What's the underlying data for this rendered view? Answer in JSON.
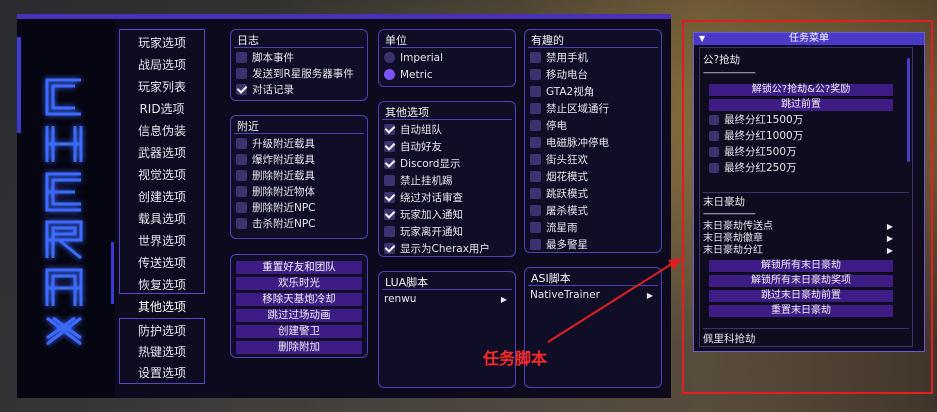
{
  "logo_text": "CHERAX",
  "main_menu": {
    "group1": [
      "玩家选项",
      "战局选项",
      "玩家列表",
      "RID选项",
      "信息伪装",
      "武器选项",
      "视觉选项",
      "创建选项",
      "载具选项",
      "世界选项",
      "传送选项",
      "恢复选项"
    ],
    "active": "其他选项",
    "group2": [
      "防护选项",
      "热键选项",
      "设置选项"
    ]
  },
  "log_panel": {
    "title": "日志",
    "items": [
      {
        "label": "脚本事件",
        "checked": false
      },
      {
        "label": "发送到R星服务器事件",
        "checked": false
      },
      {
        "label": "对话记录",
        "checked": true
      }
    ]
  },
  "nearby_panel": {
    "title": "附近",
    "items": [
      {
        "label": "升级附近载具",
        "checked": false
      },
      {
        "label": "爆炸附近载具",
        "checked": false
      },
      {
        "label": "删除附近载具",
        "checked": false
      },
      {
        "label": "删除附近物体",
        "checked": false
      },
      {
        "label": "删除附近NPC",
        "checked": false
      },
      {
        "label": "击杀附近NPC",
        "checked": false
      }
    ]
  },
  "action_buttons": [
    "重置好友和团队",
    "欢乐时光",
    "移除天基炮冷却",
    "跳过过场动画",
    "创建警卫",
    "删除附加"
  ],
  "unit_panel": {
    "title": "单位",
    "options": [
      {
        "label": "Imperial",
        "selected": false
      },
      {
        "label": "Metric",
        "selected": true
      }
    ]
  },
  "other_panel": {
    "title": "其他选项",
    "items": [
      {
        "label": "自动组队",
        "checked": true
      },
      {
        "label": "自动好友",
        "checked": true
      },
      {
        "label": "Discord显示",
        "checked": true
      },
      {
        "label": "禁止挂机踢",
        "checked": false
      },
      {
        "label": "绕过对话审查",
        "checked": true
      },
      {
        "label": "玩家加入通知",
        "checked": true
      },
      {
        "label": "玩家离开通知",
        "checked": false
      },
      {
        "label": "显示为Cherax用户",
        "checked": true
      }
    ]
  },
  "lua_panel": {
    "title": "LUA脚本",
    "item": "renwu",
    "arrow": "▶"
  },
  "fun_panel": {
    "title": "有趣的",
    "items": [
      {
        "label": "禁用手机",
        "checked": false
      },
      {
        "label": "移动电台",
        "checked": false
      },
      {
        "label": "GTA2视角",
        "checked": false
      },
      {
        "label": "禁止区域通行",
        "checked": false
      },
      {
        "label": "停电",
        "checked": false
      },
      {
        "label": "电磁脉冲停电",
        "checked": false
      },
      {
        "label": "街头狂欢",
        "checked": false
      },
      {
        "label": "烟花模式",
        "checked": false
      },
      {
        "label": "跳跃模式",
        "checked": false
      },
      {
        "label": "屠杀模式",
        "checked": false
      },
      {
        "label": "流星雨",
        "checked": false
      },
      {
        "label": "最多警星",
        "checked": false
      }
    ]
  },
  "asi_panel": {
    "title": "ASI脚本",
    "item": "NativeTrainer",
    "arrow": "▶"
  },
  "mission_menu": {
    "title": "任务菜单",
    "collapse_icon": "▼",
    "section1": "公?抢劫",
    "dashes": "-----------------------",
    "btn1": "解锁公?抢劫&公?奖励",
    "btn2": "跳过前置",
    "bonuses": [
      "最终分红1500万",
      "最终分红1000万",
      "最终分红500万",
      "最终分红250万"
    ],
    "section2": "末日豪劫",
    "dashes2": "-----------------------",
    "rows": [
      "末日豪劫传送点",
      "末日豪劫徽章",
      "末日豪劫分红"
    ],
    "arrow": "▶",
    "btns2": [
      "解锁所有末日豪劫",
      "解锁所有末日豪劫奖项",
      "跳过末日豪劫前置",
      "重置末日豪劫"
    ],
    "section3": "佩里科抢劫"
  },
  "annotation": "任务脚本",
  "colors": {
    "accent": "#4a2fb8",
    "button": "#3e1c86",
    "annotation": "#e02020"
  }
}
